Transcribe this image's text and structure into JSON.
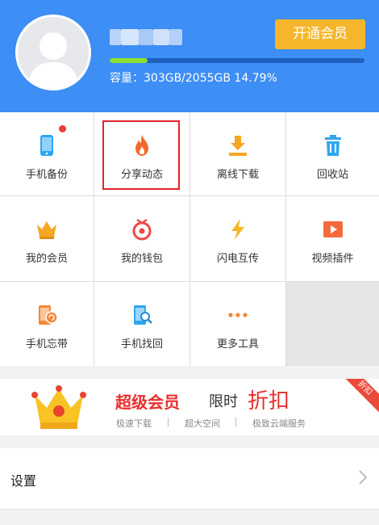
{
  "header": {
    "vip_button": "开通会员",
    "capacity_text": "容量：303GB/2055GB 14.79%",
    "usage_percent": 14.79
  },
  "tools": [
    {
      "label": "手机备份",
      "icon": "phone-backup-icon",
      "badge": true
    },
    {
      "label": "分享动态",
      "icon": "fire-icon",
      "selected": true
    },
    {
      "label": "离线下载",
      "icon": "download-icon"
    },
    {
      "label": "回收站",
      "icon": "trash-icon"
    },
    {
      "label": "我的会员",
      "icon": "crown-icon"
    },
    {
      "label": "我的钱包",
      "icon": "wallet-icon"
    },
    {
      "label": "闪电互传",
      "icon": "lightning-icon"
    },
    {
      "label": "视频插件",
      "icon": "video-play-icon"
    },
    {
      "label": "手机忘带",
      "icon": "phone-forgot-icon"
    },
    {
      "label": "手机找回",
      "icon": "phone-search-icon"
    },
    {
      "label": "更多工具",
      "icon": "more-dots-icon"
    }
  ],
  "promo": {
    "title": "超级会员",
    "limited": "限时",
    "discount": "折扣",
    "features": [
      "极速下载",
      "超大空间",
      "极致云端服务"
    ],
    "ribbon": "折扣"
  },
  "settings": {
    "label": "设置"
  },
  "colors": {
    "header_blue": "#3d8ef5",
    "vip_orange": "#f6b62c",
    "progress_green": "#8be02e",
    "promo_red": "#ea2d2d"
  }
}
